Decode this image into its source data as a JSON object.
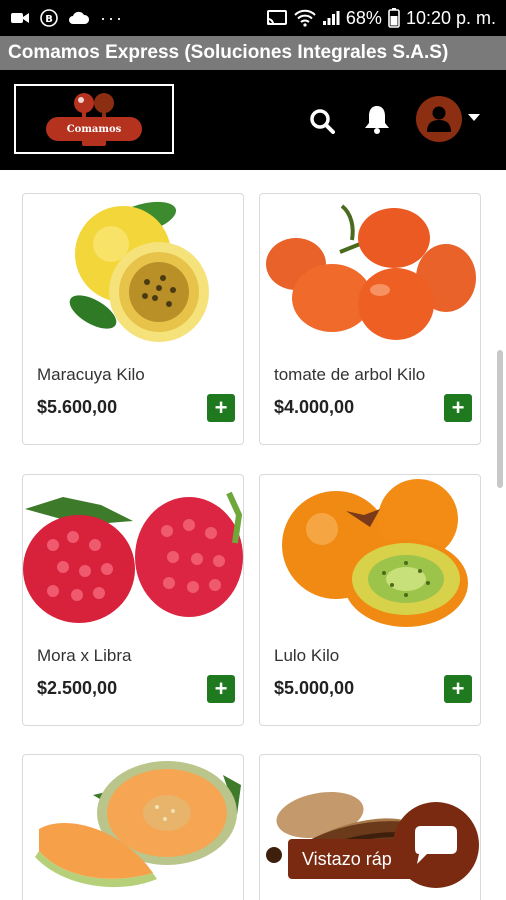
{
  "status_bar": {
    "battery": "68%",
    "time": "10:20 p. m.",
    "dots": "···"
  },
  "app": {
    "title": "Comamos Express (Soluciones Integrales S.A.S)"
  },
  "header": {
    "logo_text": "Comamos",
    "accent_color": "#8c2e12"
  },
  "products": [
    {
      "name": "Maracuya Kilo",
      "price": "$5.600,00",
      "image": "passion-fruit"
    },
    {
      "name": "tomate de arbol Kilo",
      "price": "$4.000,00",
      "image": "tree-tomato"
    },
    {
      "name": "Mora x Libra",
      "price": "$2.500,00",
      "image": "raspberries"
    },
    {
      "name": "Lulo Kilo",
      "price": "$5.000,00",
      "image": "lulo"
    },
    {
      "name": "",
      "price": "",
      "image": "cantaloupe"
    },
    {
      "name": "",
      "price": "",
      "image": "tamarind"
    }
  ],
  "add_label": "+",
  "chat": {
    "quick_view_label": "Vistazo ráp"
  },
  "colors": {
    "add_button": "#1f7a1f",
    "chat": "#7a2a10",
    "title_bar": "#7a7a7a"
  }
}
